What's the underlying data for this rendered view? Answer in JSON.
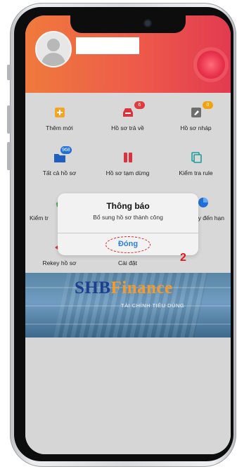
{
  "header": {
    "avatar_icon": "user-avatar-icon",
    "fab_icon": "record-button-icon",
    "brand_color": "#ee5a4a"
  },
  "tiles": [
    {
      "label": "Thêm mới",
      "icon": "plus-square-icon",
      "badge": ""
    },
    {
      "label": "Hồ sơ trả về",
      "icon": "inbox-return-icon",
      "badge": "6"
    },
    {
      "label": "Hồ sơ nháp",
      "icon": "edit-draft-icon",
      "badge": "0"
    },
    {
      "label": "Tất cả hồ sơ",
      "icon": "folder-icon",
      "badge": "968"
    },
    {
      "label": "Hồ sơ tạm dừng",
      "icon": "pause-icon",
      "badge": ""
    },
    {
      "label": "Kiểm tra rule",
      "icon": "check-docs-icon",
      "badge": ""
    },
    {
      "label": "Kiểm tr",
      "icon": "send-icon",
      "badge": ""
    },
    {
      "label": "y đến hạn",
      "icon": "pie-chart-icon",
      "badge": ""
    },
    {
      "label": "Rekey hồ sơ",
      "icon": "rewind-icon",
      "badge": ""
    },
    {
      "label": "Cài đặt",
      "icon": "gear-icon",
      "badge": ""
    }
  ],
  "banner": {
    "brand_main": "SHB",
    "brand_accent": "Finance",
    "tagline": "TÀI CHÍNH TIÊU DÙNG"
  },
  "dialog": {
    "title": "Thông báo",
    "message": "Bổ sung hồ sơ thành công",
    "button_label": "Đóng"
  },
  "annotation": {
    "step_number": "2",
    "color": "#e3141a"
  }
}
